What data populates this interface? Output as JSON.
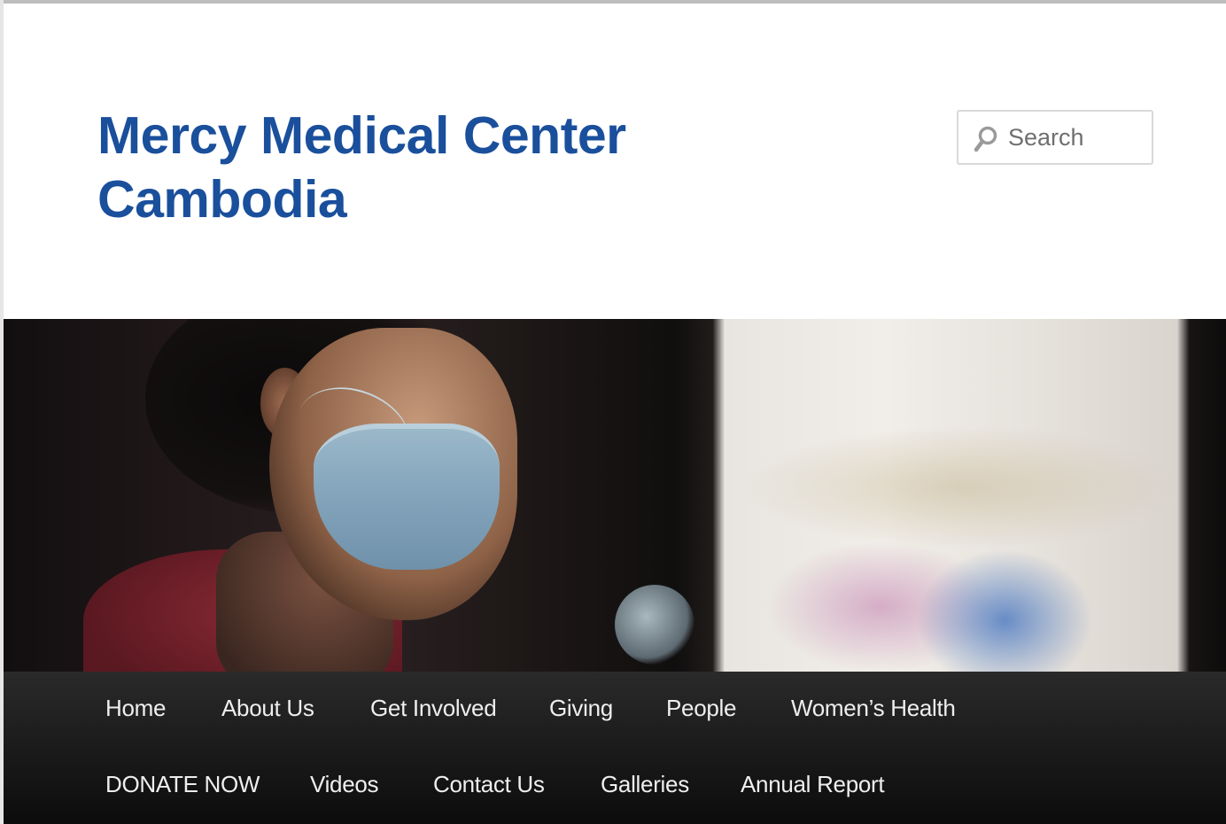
{
  "site": {
    "title_line1": "Mercy Medical Center",
    "title_line2": "Cambodia"
  },
  "search": {
    "placeholder": "Search",
    "icon": "search-icon"
  },
  "hero": {
    "image": "header-photo-masked-health-worker"
  },
  "nav": {
    "row1": [
      "Home",
      "About Us",
      "Get Involved",
      "Giving",
      "People",
      "Women’s Health"
    ],
    "row2": [
      "DONATE NOW",
      "Videos",
      "Contact Us",
      "Galleries",
      "Annual Report"
    ]
  },
  "colors": {
    "title": "#1a4f9c",
    "nav_bg": "#1a1a1a",
    "nav_text": "#eeeeee"
  }
}
